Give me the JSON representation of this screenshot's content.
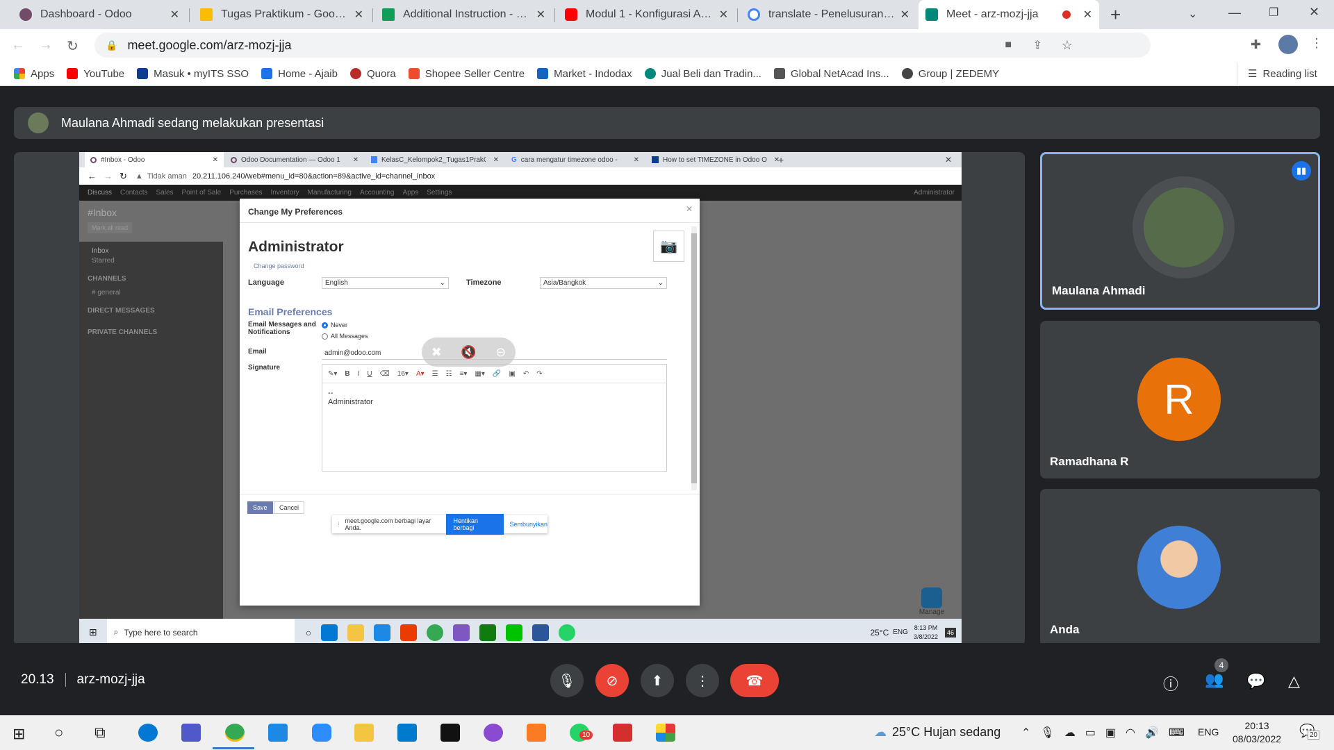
{
  "browser": {
    "tabs": [
      {
        "label": "Dashboard - Odoo",
        "color": "#714b67"
      },
      {
        "label": "Tugas Praktikum - Google D",
        "color": "#fbbc04"
      },
      {
        "label": "Additional Instruction - Goo",
        "color": "#0f9d58"
      },
      {
        "label": "Modul 1 - Konfigurasi Awal",
        "color": "#ff0000"
      },
      {
        "label": "translate - Penelusuran Goo",
        "color": "#4285f4"
      },
      {
        "label": "Meet - arz-mozj-jja",
        "color": "#00897b"
      }
    ],
    "url": "meet.google.com/arz-mozj-jja",
    "bookmarks": [
      "Apps",
      "YouTube",
      "Masuk • myITS SSO",
      "Home - Ajaib",
      "Quora",
      "Shopee Seller Centre",
      "Market - Indodax",
      "Jual Beli dan Tradin...",
      "Global NetAcad Ins...",
      "Group | ZEDEMY"
    ],
    "bookmark_colors": [
      "#ea4335",
      "#ff0000",
      "#0b3d91",
      "#1a73e8",
      "#b92b27",
      "#ee4d2d",
      "#1565c0",
      "#00897b",
      "#555555",
      "#444444"
    ],
    "reading_list": "Reading list"
  },
  "meet": {
    "banner": "Maulana Ahmadi sedang melakukan presentasi",
    "participants": [
      {
        "name": "Maulana Ahmadi"
      },
      {
        "name": "Ramadhana R",
        "initial": "R"
      },
      {
        "name": "Anda"
      }
    ],
    "time": "20.13",
    "code": "arz-mozj-jja",
    "people_count": "4",
    "accent_red": "#ea4335"
  },
  "screen": {
    "tabs": [
      "#Inbox - Odoo",
      "Odoo Documentation — Odoo 1",
      "KelasC_Kelompok2_Tugas1PrakO",
      "cara mengatur timezone odoo -",
      "How to set TIMEZONE in Odoo O"
    ],
    "not_secure": "Tidak aman",
    "url": "20.211.106.240/web#menu_id=80&action=89&active_id=channel_inbox",
    "menu": [
      "Discuss",
      "Contacts",
      "Sales",
      "Point of Sale",
      "Purchases",
      "Inventory",
      "Manufacturing",
      "Accounting",
      "Apps",
      "Settings"
    ],
    "user": "Administrator",
    "inbox_title": "#Inbox",
    "mark_all": "Mark all read",
    "left": {
      "inbox": "Inbox",
      "starred": "Starred",
      "channels": "CHANNELS",
      "general": "# general",
      "direct": "DIRECT MESSAGES",
      "private": "PRIVATE CHANNELS"
    },
    "modal": {
      "title": "Change My Preferences",
      "name": "Administrator",
      "change_password": "Change password",
      "language_label": "Language",
      "language": "English",
      "timezone_label": "Timezone",
      "timezone": "Asia/Bangkok",
      "email_pref": "Email Preferences",
      "email_msgs_label": "Email Messages and Notifications",
      "opt_never": "Never",
      "opt_all": "All Messages",
      "email_label": "Email",
      "email": "admin@odoo.com",
      "signature_label": "Signature",
      "sig_line1": "--",
      "sig_line2": "Administrator",
      "font_size": "16",
      "save": "Save",
      "cancel": "Cancel"
    },
    "share_msg": "meet.google.com berbagi layar Anda.",
    "stop_share": "Hentikan berbagi",
    "hide": "Sembunyikan",
    "manage": "Manage",
    "taskbar": {
      "search": "Type here to search",
      "temp": "25°C",
      "lang": "ENG",
      "time": "8:13 PM",
      "date": "3/8/2022",
      "notif": "46"
    }
  },
  "taskbar": {
    "weather": "25°C  Hujan sedang",
    "lang": "ENG",
    "time": "20:13",
    "date": "08/03/2022",
    "notif": "20",
    "whatsapp_badge": "10"
  }
}
